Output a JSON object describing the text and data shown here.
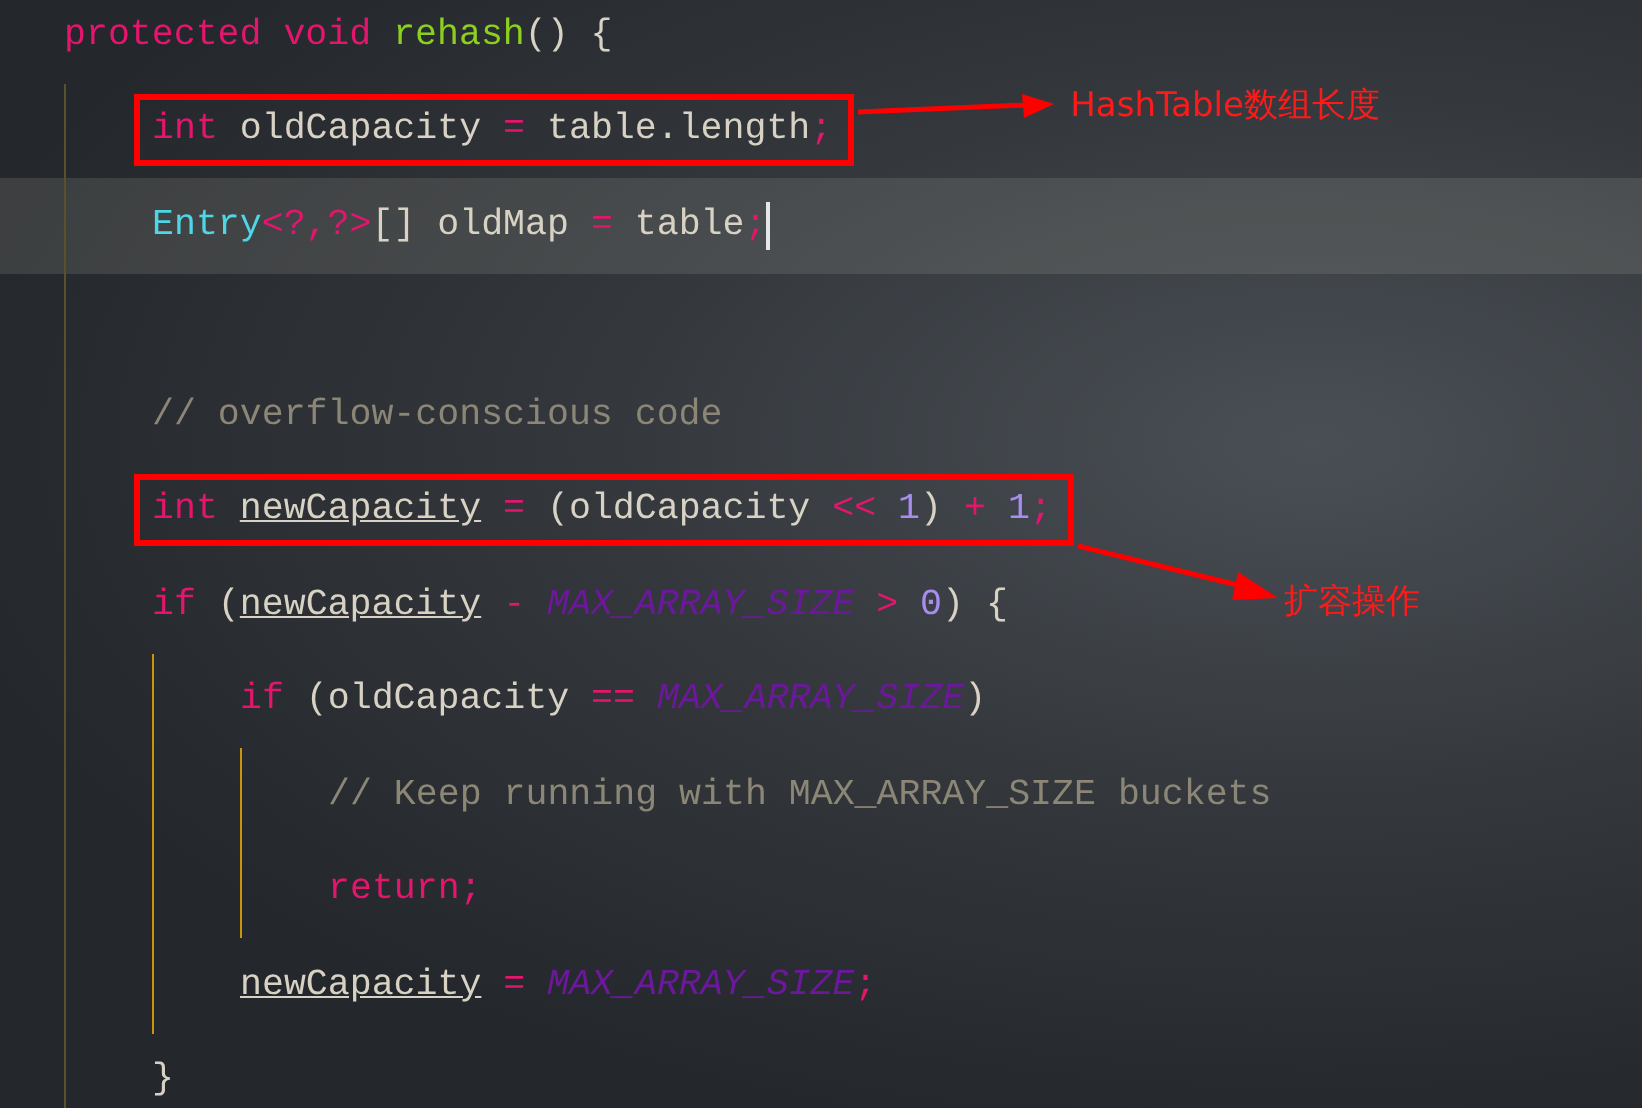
{
  "editor": {
    "lines": [
      {
        "kind": "code",
        "current": false,
        "tokens": [
          {
            "text": "protected void ",
            "kind": "keyword"
          },
          {
            "text": "rehash",
            "kind": "method"
          },
          {
            "text": "() {",
            "kind": "plain"
          }
        ],
        "children": [
          {
            "kind": "code",
            "current": false,
            "annotation": {
              "text": "HashTable数组长度",
              "kind": "beside"
            },
            "tokens": [
              {
                "text": "int ",
                "kind": "keyword"
              },
              {
                "text": "oldCapacity ",
                "kind": "plain"
              },
              {
                "text": "= ",
                "kind": "operator"
              },
              {
                "text": "table.length",
                "kind": "plain"
              },
              {
                "text": ";",
                "kind": "operator"
              }
            ]
          },
          {
            "kind": "code",
            "current": true,
            "tokens": [
              {
                "text": "Entry",
                "kind": "type"
              },
              {
                "text": "<?,?>",
                "kind": "operator"
              },
              {
                "text": "[] oldMap ",
                "kind": "plain"
              },
              {
                "text": "= ",
                "kind": "operator"
              },
              {
                "text": "table",
                "kind": "plain"
              },
              {
                "text": ";",
                "kind": "operator"
              }
            ]
          },
          {
            "kind": "blank"
          },
          {
            "kind": "code",
            "current": false,
            "tokens": [
              {
                "text": "// overflow-conscious code",
                "kind": "comment"
              }
            ]
          },
          {
            "kind": "code",
            "current": false,
            "annotation": {
              "text": "扩容操作",
              "kind": "below"
            },
            "tokens": [
              {
                "text": "int ",
                "kind": "keyword"
              },
              {
                "text": "newCapacity",
                "kind": "field"
              },
              {
                "text": " = ",
                "kind": "operator"
              },
              {
                "text": "(oldCapacity ",
                "kind": "plain"
              },
              {
                "text": "<< ",
                "kind": "operator"
              },
              {
                "text": "1",
                "kind": "number"
              },
              {
                "text": ") ",
                "kind": "plain"
              },
              {
                "text": "+ ",
                "kind": "operator"
              },
              {
                "text": "1",
                "kind": "number"
              },
              {
                "text": ";",
                "kind": "operator"
              }
            ]
          },
          {
            "kind": "code",
            "current": false,
            "tokens": [
              {
                "text": "if ",
                "kind": "keyword"
              },
              {
                "text": "(",
                "kind": "plain"
              },
              {
                "text": "newCapacity",
                "kind": "field"
              },
              {
                "text": " - ",
                "kind": "operator"
              },
              {
                "text": "MAX_ARRAY_SIZE",
                "kind": "constant"
              },
              {
                "text": " > ",
                "kind": "operator"
              },
              {
                "text": "0",
                "kind": "number"
              },
              {
                "text": ") {",
                "kind": "plain"
              }
            ],
            "children": [
              {
                "kind": "code",
                "current": false,
                "tokens": [
                  {
                    "text": "if ",
                    "kind": "keyword"
                  },
                  {
                    "text": "(oldCapacity ",
                    "kind": "plain"
                  },
                  {
                    "text": "== ",
                    "kind": "operator"
                  },
                  {
                    "text": "MAX_ARRAY_SIZE",
                    "kind": "constant"
                  },
                  {
                    "text": ")",
                    "kind": "plain"
                  }
                ],
                "children": [
                  {
                    "kind": "code",
                    "current": false,
                    "tokens": [
                      {
                        "text": "// Keep running with MAX_ARRAY_SIZE buckets",
                        "kind": "comment"
                      }
                    ]
                  },
                  {
                    "kind": "code",
                    "current": false,
                    "tokens": [
                      {
                        "text": "return;",
                        "kind": "keyword"
                      }
                    ]
                  }
                ]
              },
              {
                "kind": "code",
                "current": false,
                "tokens": [
                  {
                    "text": "newCapacity",
                    "kind": "field"
                  },
                  {
                    "text": " = ",
                    "kind": "operator"
                  },
                  {
                    "text": "MAX_ARRAY_SIZE",
                    "kind": "constant"
                  },
                  {
                    "text": ";",
                    "kind": "operator"
                  }
                ]
              }
            ]
          },
          {
            "kind": "code",
            "current": false,
            "tokens": [
              {
                "text": "}",
                "kind": "plain"
              }
            ]
          }
        ]
      }
    ]
  }
}
